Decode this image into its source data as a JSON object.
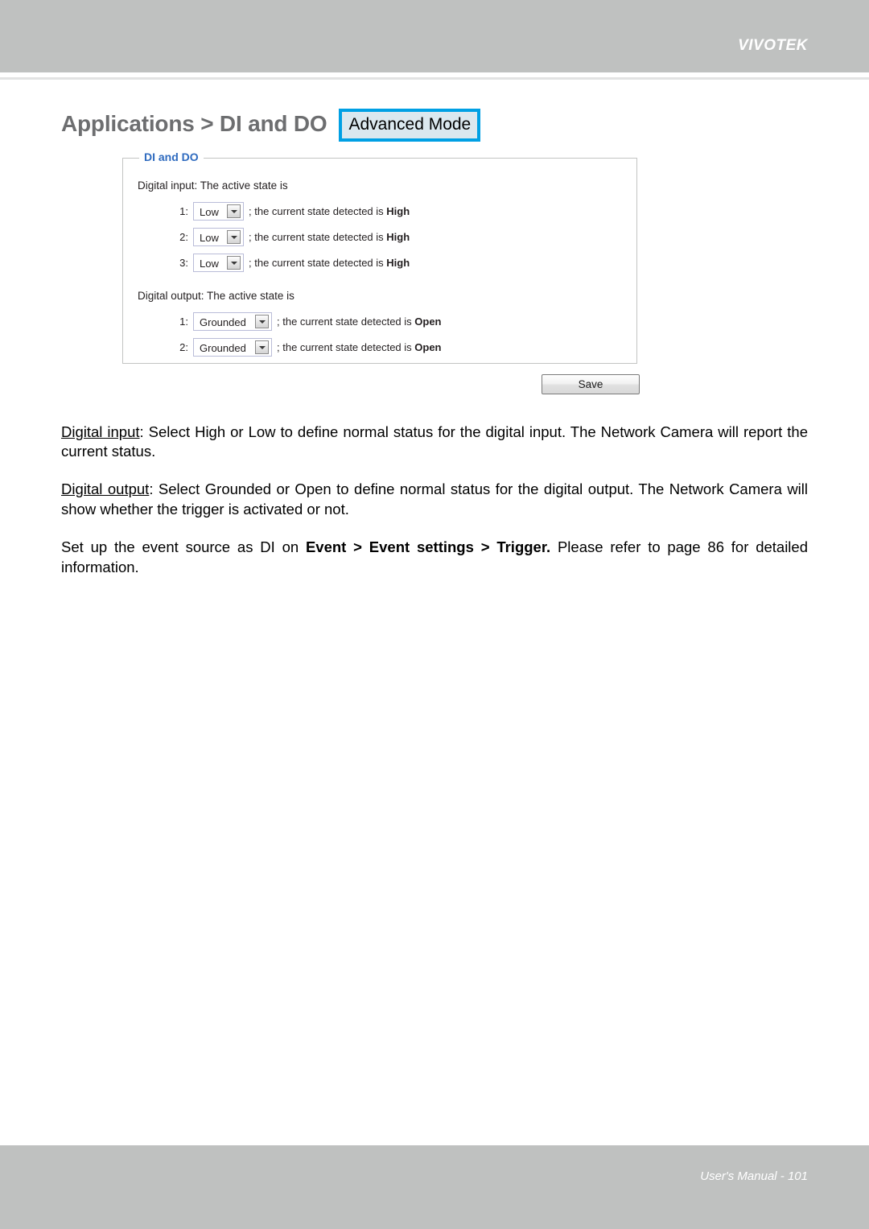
{
  "header": {
    "brand": "VIVOTEK"
  },
  "title": {
    "text": "Applications > DI and DO",
    "badge": "Advanced Mode"
  },
  "panel": {
    "legend": "DI and DO",
    "digital_input": {
      "label": "Digital input: The active state is",
      "rows": [
        {
          "index": "1:",
          "value": "Low",
          "text_before": "; the current state detected is ",
          "state": "High"
        },
        {
          "index": "2:",
          "value": "Low",
          "text_before": "; the current state detected is ",
          "state": "High"
        },
        {
          "index": "3:",
          "value": "Low",
          "text_before": "; the current state detected is ",
          "state": "High"
        }
      ]
    },
    "digital_output": {
      "label": "Digital output: The active state is",
      "rows": [
        {
          "index": "1:",
          "value": "Grounded",
          "text_before": "; the current state detected is ",
          "state": "Open"
        },
        {
          "index": "2:",
          "value": "Grounded",
          "text_before": "; the current state detected is ",
          "state": "Open"
        }
      ]
    }
  },
  "actions": {
    "save_label": "Save"
  },
  "paragraphs": {
    "p1_term": "Digital input",
    "p1_body": ": Select High or Low to define normal status for the digital input. The Network Camera will report the current status.",
    "p2_term": "Digital output",
    "p2_body": ": Select Grounded or Open to define normal status for the digital output. The Network Camera will show whether the trigger is activated or not.",
    "p3_a": "Set up the event source as DI on ",
    "p3_bold": "Event > Event settings > Trigger.",
    "p3_b": " Please refer to page 86 for detailed information."
  },
  "footer": {
    "text": "User's Manual - 101"
  },
  "colors": {
    "header_gray": "#bfc1c0",
    "title_gray": "#6d6e70",
    "badge_border": "#00a0e4",
    "badge_fill": "#dbe8ef",
    "legend_blue": "#2f6bbf",
    "panel_border": "#c3c4c3",
    "select_border": "#b9bcd8"
  }
}
